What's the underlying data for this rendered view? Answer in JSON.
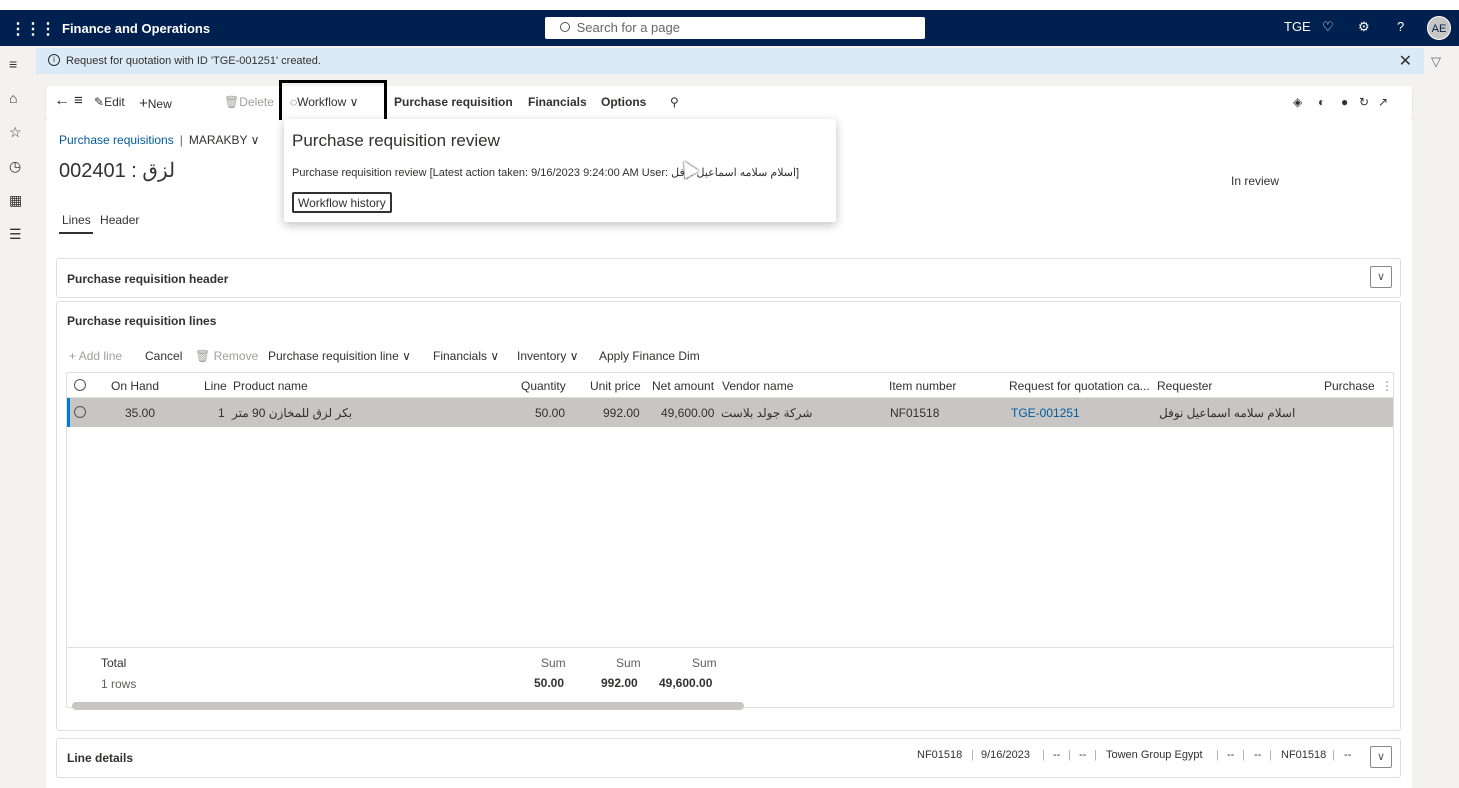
{
  "topbar": {
    "app_title": "Finance and Operations",
    "search_placeholder": "Search for a page",
    "company": "TGE",
    "avatar": "AE",
    "help": "?"
  },
  "message": {
    "text": "Request for quotation with ID 'TGE-001251' created."
  },
  "commands": {
    "edit": "Edit",
    "new": "New",
    "delete": "Delete",
    "workflow": "Workflow",
    "purchase_requisition": "Purchase requisition",
    "financials": "Financials",
    "options": "Options"
  },
  "breadcrumb": {
    "link": "Purchase requisitions",
    "company": "MARAKBY"
  },
  "record": {
    "title": "002401 : لزق",
    "status": "In review"
  },
  "tabs": [
    "Lines",
    "Header"
  ],
  "popup": {
    "title": "Purchase requisition review",
    "text": "Purchase requisition review [Latest action taken: 9/16/2023 9:24:00 AM User: اسلام سلامه اسماعيل نوفل]",
    "button": "Workflow history"
  },
  "sections": {
    "header": "Purchase requisition header",
    "lines": "Purchase requisition lines",
    "line_details": "Line details"
  },
  "lines_commands": {
    "add_line": "Add line",
    "cancel": "Cancel",
    "remove": "Remove",
    "pr_line": "Purchase requisition line",
    "financials": "Financials",
    "inventory": "Inventory",
    "apply_finance_dim": "Apply Finance Dim"
  },
  "grid": {
    "columns": [
      "On Hand",
      "Line",
      "Product name",
      "Quantity",
      "Unit price",
      "Net amount",
      "Vendor name",
      "Item number",
      "Request for quotation ca...",
      "Requester",
      "Purchase"
    ],
    "row": {
      "on_hand": "35.00",
      "line": "1",
      "product_name": "بكر لزق للمخازن 90 متر",
      "quantity": "50.00",
      "unit_price": "992.00",
      "net_amount": "49,600.00",
      "vendor_name": "شركة جولد بلاست",
      "item_number": "NF01518",
      "rfq": "TGE-001251",
      "requester": "اسلام سلامه اسماعيل نوفل"
    },
    "footer": {
      "total": "Total",
      "rows": "1 rows",
      "sum_label": "Sum",
      "quantity": "50.00",
      "unit_price": "992.00",
      "net_amount": "49,600.00"
    }
  },
  "line_details_values": [
    "NF01518",
    "9/16/2023",
    "--",
    "--",
    "Towen Group Egypt",
    "--",
    "--",
    "NF01518",
    "--"
  ]
}
